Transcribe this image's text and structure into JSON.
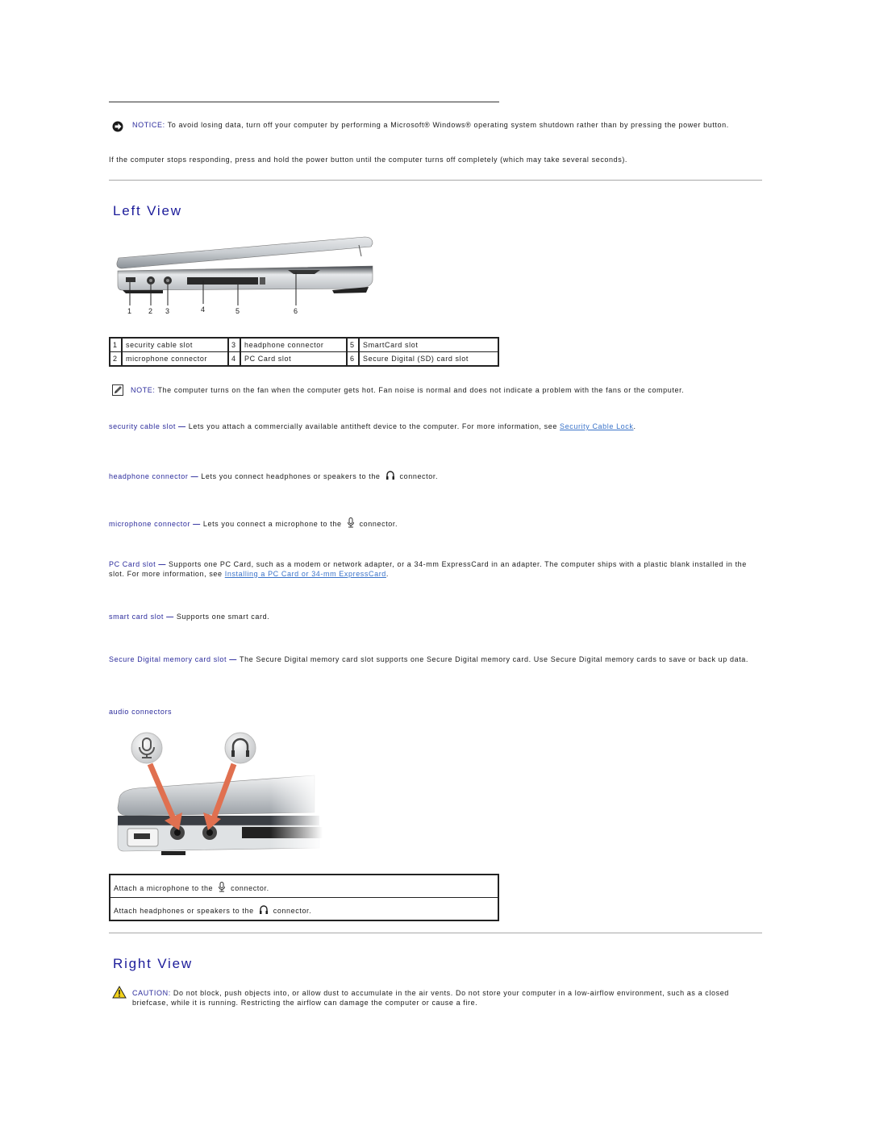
{
  "notice": {
    "label": "NOTICE:",
    "text": " To avoid losing data, turn off your computer by performing a Microsoft® Windows® operating system shutdown rather than by pressing the power button.",
    "icon": "notice-arrow-icon"
  },
  "intro_paragraph": "If the computer stops responding, press and hold the power button until the computer turns off completely (which may take several seconds).",
  "left_view": {
    "heading": "Left View",
    "figure_callouts": [
      "1",
      "2",
      "3",
      "4",
      "5",
      "6"
    ],
    "parts_table": [
      [
        {
          "num": "1",
          "label": "security cable slot"
        },
        {
          "num": "3",
          "label": "headphone connector"
        },
        {
          "num": "5",
          "label": "SmartCard slot"
        }
      ],
      [
        {
          "num": "2",
          "label": "microphone connector"
        },
        {
          "num": "4",
          "label": "PC Card slot"
        },
        {
          "num": "6",
          "label": "Secure Digital (SD) card slot"
        }
      ]
    ],
    "note": {
      "label": "NOTE:",
      "text": " The computer turns on the fan when the computer gets hot. Fan noise is normal and does not indicate a problem with the fans or the computer.",
      "icon": "note-pencil-icon"
    },
    "descriptions": {
      "security": {
        "term": "security cable slot",
        "dash": " — ",
        "text": "Lets you attach a commercially available antitheft device to the computer. For more information, see ",
        "link": "Security Cable Lock",
        "after": "."
      },
      "headphone": {
        "term": "headphone connector",
        "dash": " — ",
        "text": "Lets you connect headphones or speakers to the",
        "after": "connector."
      },
      "microphone": {
        "term": "microphone connector",
        "dash": " — ",
        "text": "Lets you connect a microphone to the",
        "after": "connector."
      },
      "pccard": {
        "term": "PC Card slot",
        "dash": " — ",
        "text": "Supports one PC Card, such as a modem or network adapter, or a 34-mm ExpressCard in an adapter. The computer ships with a plastic blank installed in the slot. For more information, see ",
        "link": "Installing a PC Card or 34-mm ExpressCard",
        "after": "."
      },
      "smartcard": {
        "term": "smart card slot",
        "dash": " — ",
        "text": "Supports one smart card."
      },
      "sd": {
        "term": "Secure Digital memory card slot",
        "dash": " — ",
        "text": "The Secure Digital memory card slot supports one Secure Digital memory card. Use Secure Digital memory cards to save or back up data."
      }
    },
    "audio_heading": "audio connectors",
    "audio_table": [
      {
        "before": "Attach a microphone to the",
        "after": "connector.",
        "icon": "microphone-icon"
      },
      {
        "before": "Attach headphones or speakers to the",
        "after": "connector.",
        "icon": "headphone-icon"
      }
    ]
  },
  "right_view": {
    "heading": "Right View",
    "caution": {
      "label": "CAUTION:",
      "text": " Do not block, push objects into, or allow dust to accumulate in the air vents. Do not store your computer in a low-airflow environment, such as a closed briefcase, while it is running. Restricting the airflow can damage the computer or cause a fire.",
      "icon": "warning-triangle-icon"
    }
  },
  "colors": {
    "heading": "#1c1c9a",
    "term": "#2b2b9c",
    "link": "#3a73c9",
    "arrow": "#e07050"
  }
}
